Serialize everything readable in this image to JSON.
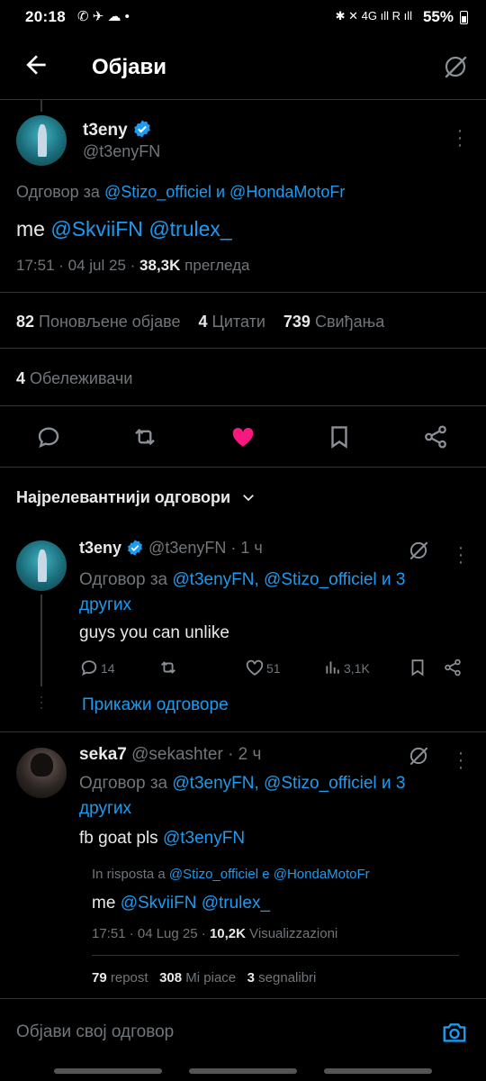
{
  "status_bar": {
    "time": "20:18",
    "left_icons": "✆ ✈ ☁ •",
    "right_icons": "✱ ✕ 4G ıll R ıll",
    "battery": "55%"
  },
  "header": {
    "title": "Објави"
  },
  "main_post": {
    "display_name": "t3eny",
    "handle": "@t3enyFN",
    "reply_prefix": "Одговор за",
    "reply_user1": "@Stizo_officiel",
    "reply_and": "и",
    "reply_user2": "@HondaMotoFr",
    "text_prefix": "me",
    "mention1": "@SkviiFN",
    "mention2": "@trulex_",
    "timestamp": "17:51 · 04 jul 25 ·",
    "views_count": "38,3K",
    "views_label": "прегледа",
    "reposts_count": "82",
    "reposts_label": "Поновљене објаве",
    "quotes_count": "4",
    "quotes_label": "Цитати",
    "likes_count": "739",
    "likes_label": "Свиђања",
    "bookmarks_count": "4",
    "bookmarks_label": "Обележивачи"
  },
  "replies_filter": {
    "label": "Најрелевантнији одговори"
  },
  "reply1": {
    "display_name": "t3eny",
    "meta": "@t3enyFN · 1 ч",
    "reply_prefix": "Одговор за",
    "reply_users": "@t3enyFN, @Stizo_officiel и 3",
    "reply_users_cont": "других",
    "text": "guys you can unlike",
    "replies": "14",
    "likes": "51",
    "views": "3,1K",
    "show_replies": "Прикажи одговоре"
  },
  "reply2": {
    "display_name": "seka7",
    "meta": "@sekashter · 2 ч",
    "reply_prefix": "Одговор за",
    "reply_users": "@t3enyFN, @Stizo_officiel и 3",
    "reply_users_cont": "других",
    "text_prefix": "fb goat pls",
    "text_mention": "@t3enyFN",
    "embedded": {
      "reply_prefix": "In risposta a",
      "reply_users": "@Stizo_officiel e @HondaMotoFr",
      "text_prefix": "me",
      "mentions": "@SkviiFN @trulex_",
      "timestamp": "17:51 · 04 Lug 25 ·",
      "views_count": "10,2K",
      "views_label": "Visualizzazioni",
      "reposts_count": "79",
      "reposts_label": "repost",
      "likes_count": "308",
      "likes_label": "Mi piace",
      "bookmarks_count": "3",
      "bookmarks_label": "segnalibri"
    }
  },
  "composer": {
    "placeholder": "Објави свој одговор"
  },
  "colors": {
    "accent": "#1d9bf0",
    "like": "#f91880",
    "text": "#e7e9ea",
    "muted": "#71767b",
    "border": "#2f3336",
    "background": "#000000"
  }
}
